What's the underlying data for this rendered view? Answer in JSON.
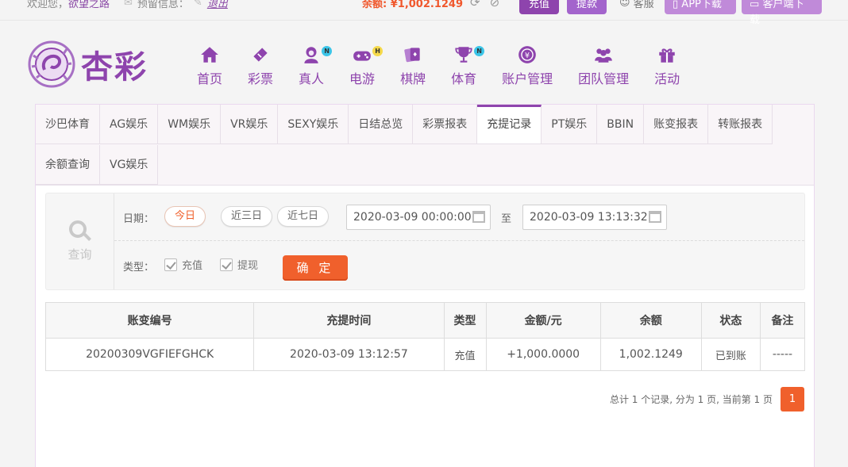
{
  "topbar": {
    "welcome": "欢迎您，",
    "username": "欲望之路",
    "message_label": "预留信息：",
    "logout": "退出",
    "balance_label": "余额: ",
    "balance": "¥1,002.1249",
    "deposit": "充值",
    "withdraw": "提款",
    "service": "客服",
    "app_download": "APP下载",
    "client_download": "客户端下载"
  },
  "logo": {
    "text": "杏彩"
  },
  "nav": [
    {
      "label": "首页",
      "icon": "home-icon",
      "badge": ""
    },
    {
      "label": "彩票",
      "icon": "ticket-icon",
      "badge": ""
    },
    {
      "label": "真人",
      "icon": "dealer-icon",
      "badge": "N"
    },
    {
      "label": "电游",
      "icon": "gamepad-icon",
      "badge": "H"
    },
    {
      "label": "棋牌",
      "icon": "cards-icon",
      "badge": ""
    },
    {
      "label": "体育",
      "icon": "trophy-icon",
      "badge": "N"
    },
    {
      "label": "账户管理",
      "icon": "account-icon",
      "badge": ""
    },
    {
      "label": "团队管理",
      "icon": "team-icon",
      "badge": ""
    },
    {
      "label": "活动",
      "icon": "gift-icon",
      "badge": ""
    }
  ],
  "tabs": [
    {
      "label": "沙巴体育"
    },
    {
      "label": "AG娱乐"
    },
    {
      "label": "WM娱乐"
    },
    {
      "label": "VR娱乐"
    },
    {
      "label": "SEXY娱乐"
    },
    {
      "label": "日结总览"
    },
    {
      "label": "彩票报表"
    },
    {
      "label": "充提记录",
      "active": true
    },
    {
      "label": "PT娱乐"
    },
    {
      "label": "BBIN"
    },
    {
      "label": "账变报表"
    },
    {
      "label": "转账报表"
    },
    {
      "label": "余额查询"
    },
    {
      "label": "VG娱乐"
    }
  ],
  "query": {
    "title": "查询",
    "date_label": "日期：",
    "ranges": [
      "今日",
      "近三日",
      "近七日"
    ],
    "start": "2020-03-09 00:00:00",
    "to": "至",
    "end": "2020-03-09 13:13:32",
    "type_label": "类型：",
    "type_deposit": "充值",
    "type_withdraw": "提现",
    "confirm": "确 定"
  },
  "table": {
    "headers": [
      "账变编号",
      "充提时间",
      "类型",
      "金额/元",
      "余额",
      "状态",
      "备注"
    ],
    "rows": [
      [
        "20200309VGFIEFGHCK",
        "2020-03-09 13:12:57",
        "充值",
        "+1,000.0000",
        "1,002.1249",
        "已到账",
        "-----"
      ]
    ]
  },
  "pager": {
    "summary": "总计 1 个记录, 分为 1 页, 当前第 1 页",
    "page": "1"
  },
  "colors": {
    "brand": "#8e44ad",
    "accent": "#f0602c",
    "success": "#2a9a2a",
    "amount": "#e0382c"
  }
}
